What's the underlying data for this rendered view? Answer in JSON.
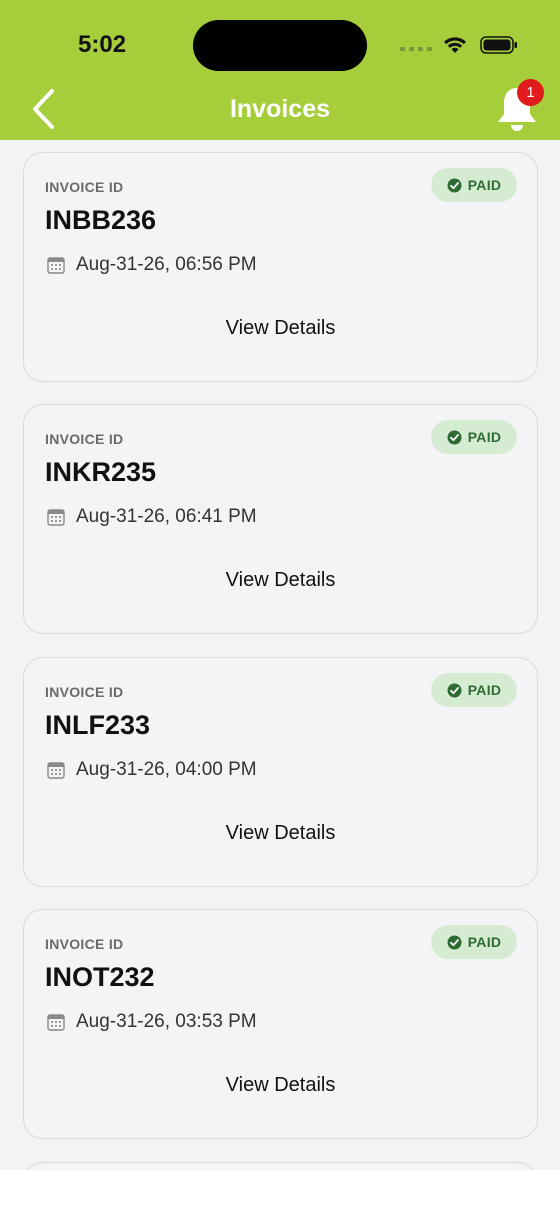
{
  "status_bar": {
    "time": "5:02"
  },
  "header": {
    "title": "Invoices",
    "notification_count": "1"
  },
  "invoices": [
    {
      "label": "INVOICE ID",
      "id": "INBB236",
      "date": "Aug-31-26, 06:56 PM",
      "status": "PAID",
      "action": "View Details"
    },
    {
      "label": "INVOICE ID",
      "id": "INKR235",
      "date": "Aug-31-26, 06:41 PM",
      "status": "PAID",
      "action": "View Details"
    },
    {
      "label": "INVOICE ID",
      "id": "INLF233",
      "date": "Aug-31-26, 04:00 PM",
      "status": "PAID",
      "action": "View Details"
    },
    {
      "label": "INVOICE ID",
      "id": "INOT232",
      "date": "Aug-31-26, 03:53 PM",
      "status": "PAID",
      "action": "View Details"
    }
  ],
  "icons": {
    "back": "chevron-left-icon",
    "notifications": "bell-icon",
    "date": "calendar-icon",
    "status": "check-circle-icon"
  },
  "colors": {
    "header": "#a6cd3a",
    "badge": "#e11b1b",
    "paid_bg": "#d6ecd2",
    "paid_text": "#2e6b33"
  }
}
